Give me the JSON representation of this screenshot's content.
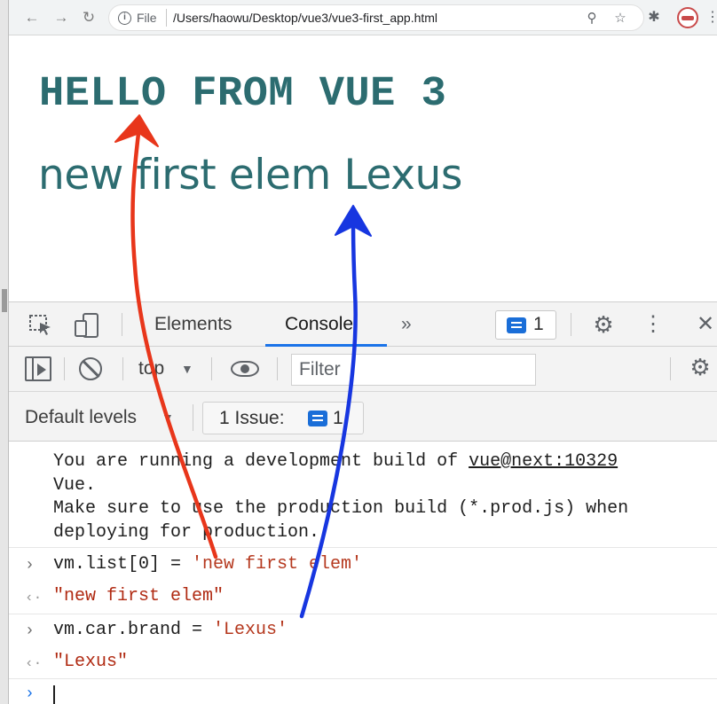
{
  "browser": {
    "url_scheme": "File",
    "url": "/Users/haowu/Desktop/vue3/vue3-first_app.html",
    "icons": [
      "back-arrow-icon",
      "forward-arrow-icon",
      "reload-icon",
      "info-icon",
      "zoom-icon",
      "star-icon",
      "extensions-icon",
      "profile-avatar"
    ]
  },
  "page": {
    "heading": "HELLO FROM VUE 3",
    "first_item": "new first elem Lexus"
  },
  "devtools": {
    "tabs": [
      {
        "label": "Elements"
      },
      {
        "label": "Console",
        "active": true
      }
    ],
    "more_tabs": "»",
    "issues_count": "1",
    "context": "top",
    "filter_placeholder": "Filter",
    "levels": "Default levels",
    "issue_label": "1 Issue:",
    "issue_badge_count": "1",
    "console": {
      "warning": {
        "line1_prefix": "You are running a development build of ",
        "link": "vue@next:10329",
        "line2": "Vue.",
        "line3": "Make sure to use the production build (*.prod.js) when",
        "line4": "deploying for production."
      },
      "entries": [
        {
          "input_code": "vm.list[0] = ",
          "input_str": "'new first elem'",
          "result": "\"new first elem\""
        },
        {
          "input_code": "vm.car.brand = ",
          "input_str": "'Lexus'",
          "result": "\"Lexus\""
        }
      ]
    }
  },
  "annotations": {
    "arrow_colors": [
      "#e8361b",
      "#1736e0"
    ]
  }
}
